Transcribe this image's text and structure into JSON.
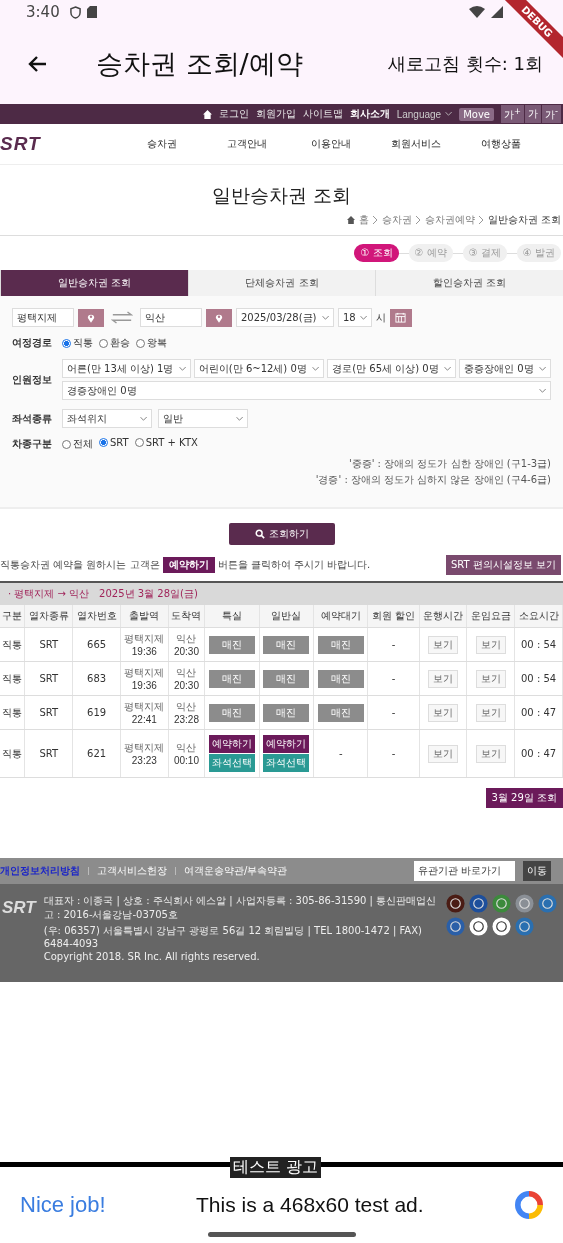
{
  "status_bar": {
    "time": "3:40"
  },
  "debug_banner": "DEBUG",
  "app_bar": {
    "title": "승차권 조회/예약",
    "refresh_count": "새로고침 횟수: 1회"
  },
  "util_menu": {
    "links": [
      {
        "label": "로그인",
        "bold": false
      },
      {
        "label": "회원가입",
        "bold": false
      },
      {
        "label": "사이트맵",
        "bold": false
      },
      {
        "label": "회사소개",
        "bold": true
      }
    ],
    "language": "Language",
    "move": "Move",
    "font_buttons": [
      "가$^{+}$",
      "가",
      "가$^{-}$"
    ]
  },
  "nav": {
    "logo": "SRT",
    "items": [
      "승차권",
      "고객안내",
      "이용안내",
      "회원서비스",
      "여행상품"
    ]
  },
  "page_title": "일반승차권 조회",
  "breadcrumb": [
    "홈",
    "승차권",
    "승차권예약",
    "일반승차권 조회"
  ],
  "steps": [
    {
      "label": "① 조회",
      "selected": true
    },
    {
      "label": "② 예약",
      "selected": false
    },
    {
      "label": "③ 결제",
      "selected": false
    },
    {
      "label": "④ 발권",
      "selected": false
    }
  ],
  "tabs": [
    {
      "label": "일반승차권 조회",
      "selected": true
    },
    {
      "label": "단체승차권 조회",
      "selected": false
    },
    {
      "label": "할인승차권 조회",
      "selected": false
    }
  ],
  "search": {
    "departure": "평택지제",
    "arrival": "익산",
    "date": "2025/03/28(금)",
    "hour": "18",
    "hour_unit": "시",
    "route_label": "여정경로",
    "routes": [
      {
        "label": "직통",
        "selected": true
      },
      {
        "label": "환승",
        "selected": false
      },
      {
        "label": "왕복",
        "selected": false
      }
    ],
    "passenger_label": "인원정보",
    "passengers": [
      "어른(만 13세 이상) 1명",
      "어린이(만 6~12세) 0명",
      "경로(만 65세 이상) 0명",
      "중증장애인 0명",
      "경증장애인 0명"
    ],
    "seat_label": "좌석종류",
    "seat_options": [
      "좌석위치",
      "일반"
    ],
    "train_label": "차종구분",
    "train_types": [
      {
        "label": "전체",
        "selected": false
      },
      {
        "label": "SRT",
        "selected": true
      },
      {
        "label": "SRT + KTX",
        "selected": false
      }
    ],
    "notes": [
      "'중증' : 장애의 정도가 심한 장애인 (구1-3급)",
      "'경증' : 장애의 정도가 심하지 않은 장애인 (구4-6급)"
    ],
    "button": "조회하기"
  },
  "notice": {
    "before": "직통승차권 예약을 원하시는 고객은",
    "badge": "예약하기",
    "after": "버튼을 클릭하여 주시기 바랍니다."
  },
  "facility_button": "SRT 편의시설정보 보기",
  "results": {
    "route": "· 평택지제 → 익산",
    "date": "2025년 3월 28일(금)",
    "columns": [
      "구분",
      "열차종류",
      "열차번호",
      "출발역",
      "도착역",
      "특실",
      "일반실",
      "예약대기",
      "회원 할인",
      "운행시간",
      "운임요금",
      "소요시간"
    ],
    "rows": [
      {
        "type": "직통",
        "train": "SRT",
        "number": "665",
        "dep_station": "평택지제",
        "dep_time": "19:36",
        "arr_station": "익산",
        "arr_time": "20:30",
        "first": {
          "buttons": [
            {
              "kind": "soldout",
              "label": "매진"
            }
          ]
        },
        "standard": {
          "buttons": [
            {
              "kind": "soldout",
              "label": "매진"
            }
          ]
        },
        "waitlist": {
          "buttons": [
            {
              "kind": "soldout",
              "label": "매진"
            }
          ]
        },
        "member_discount": "-",
        "schedule": "보기",
        "fare": "보기",
        "duration": "00 : 54"
      },
      {
        "type": "직통",
        "train": "SRT",
        "number": "683",
        "dep_station": "평택지제",
        "dep_time": "19:36",
        "arr_station": "익산",
        "arr_time": "20:30",
        "first": {
          "buttons": [
            {
              "kind": "soldout",
              "label": "매진"
            }
          ]
        },
        "standard": {
          "buttons": [
            {
              "kind": "soldout",
              "label": "매진"
            }
          ]
        },
        "waitlist": {
          "buttons": [
            {
              "kind": "soldout",
              "label": "매진"
            }
          ]
        },
        "member_discount": "-",
        "schedule": "보기",
        "fare": "보기",
        "duration": "00 : 54"
      },
      {
        "type": "직통",
        "train": "SRT",
        "number": "619",
        "dep_station": "평택지제",
        "dep_time": "22:41",
        "arr_station": "익산",
        "arr_time": "23:28",
        "first": {
          "buttons": [
            {
              "kind": "soldout",
              "label": "매진"
            }
          ]
        },
        "standard": {
          "buttons": [
            {
              "kind": "soldout",
              "label": "매진"
            }
          ]
        },
        "waitlist": {
          "buttons": [
            {
              "kind": "soldout",
              "label": "매진"
            }
          ]
        },
        "member_discount": "-",
        "schedule": "보기",
        "fare": "보기",
        "duration": "00 : 47"
      },
      {
        "type": "직통",
        "train": "SRT",
        "number": "621",
        "dep_station": "평택지제",
        "dep_time": "23:23",
        "arr_station": "익산",
        "arr_time": "00:10",
        "first": {
          "buttons": [
            {
              "kind": "reserve",
              "label": "예약하기"
            },
            {
              "kind": "seat",
              "label": "좌석선택"
            }
          ]
        },
        "standard": {
          "buttons": [
            {
              "kind": "reserve",
              "label": "예약하기"
            },
            {
              "kind": "seat",
              "label": "좌석선택"
            }
          ]
        },
        "waitlist": {
          "text": "-"
        },
        "member_discount": "-",
        "schedule": "보기",
        "fare": "보기",
        "duration": "00 : 47"
      }
    ]
  },
  "next_day_button": "3월 29일 조회",
  "footer": {
    "links": [
      {
        "label": "개인정보처리방침",
        "kind": "highlight"
      },
      {
        "label": "고객서비스헌장",
        "kind": "plain"
      },
      {
        "label": "여객운송약관/부속약관",
        "kind": "plain"
      }
    ],
    "related_select": "유관기관 바로가기",
    "go_button": "이동",
    "logo": "SRT",
    "info": [
      "대표자 : 이종국 | 상호 : 주식회사 에스알 | 사업자등록 : 305-86-31590 | 통신판매업신고 : 2016-서울강남-03705호",
      "(우: 06357) 서울특별시 강남구 광평로 56길 12 회림빌딩 | TEL 1800-1472 | FAX) 6484-4093",
      "Copyright 2018. SR Inc. All rights reserved."
    ]
  },
  "ad": {
    "label": "테스트 광고",
    "headline": "Nice job!",
    "text": "This is a 468x60 test ad."
  }
}
